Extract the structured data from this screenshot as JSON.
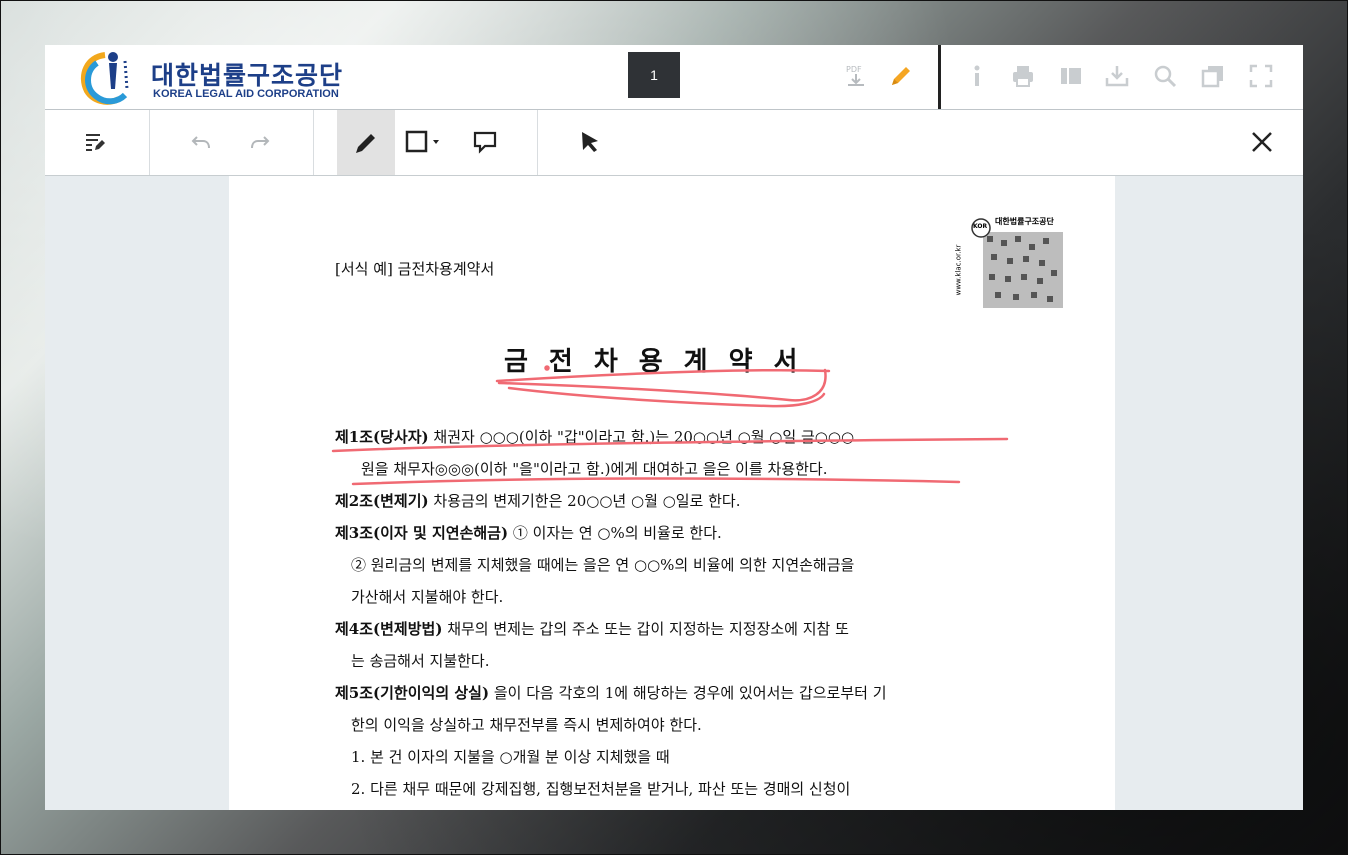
{
  "header": {
    "logo_title": "대한법률구조공단",
    "logo_subtitle": "KOREA LEGAL AID CORPORATION",
    "page_number": "1"
  },
  "icons": {
    "pdf": "pdf-download-icon",
    "pen_top": "pencil-icon",
    "info": "info-icon",
    "print": "print-icon",
    "layout": "layout-icon",
    "download": "download-icon",
    "search": "search-icon",
    "copy": "copy-icon",
    "fullscreen": "fullscreen-icon",
    "annotation_list": "annotation-list-icon",
    "undo": "undo-icon",
    "redo": "redo-icon",
    "pen": "pen-icon",
    "shape": "rectangle-shape-icon",
    "comment": "comment-icon",
    "select": "cursor-icon",
    "close": "close-icon"
  },
  "colors": {
    "accent_pen": "#f5a623",
    "annotation_ink": "#f06a73",
    "logo_blue": "#1d3f88"
  },
  "document": {
    "form_label": "[서식 예] 금전차용계약서",
    "title": "금전차용계약서",
    "stamp_text": "대한법률구조공단",
    "stamp_url": "www.klac.or.kr",
    "stamp_badge": "KOR",
    "paragraphs": [
      {
        "article": "제1조(당사자)",
        "text": " 채권자 ○○○(이하 \"갑\"이라고 함.)는 20○○년 ○월 ○일 금○○○"
      },
      {
        "article": "",
        "text": "원을 채무자◎◎◎(이하 \"을\"이라고 함.)에게 대여하고 을은 이를 차용한다."
      },
      {
        "article": "제2조(변제기)",
        "text": " 차용금의 변제기한은 20○○년 ○월 ○일로 한다."
      },
      {
        "article": "제3조(이자 및 지연손해금)",
        "text": "  ① 이자는 연 ○%의 비율로 한다."
      },
      {
        "article": "",
        "text": "② 원리금의 변제를 지체했을 때에는 을은 연  ○○%의 비율에 의한 지연손해금을"
      },
      {
        "article": "",
        "text": "가산해서 지불해야 한다."
      },
      {
        "article": "제4조(변제방법)",
        "text": " 채무의 변제는 갑의 주소 또는 갑이 지정하는 지정장소에 지참 또"
      },
      {
        "article": "",
        "text": "는 송금해서 지불한다."
      },
      {
        "article": "제5조(기한이익의 상실)",
        "text": "  을이 다음 각호의 1에 해당하는 경우에 있어서는 갑으로부터 기"
      },
      {
        "article": "",
        "text": "한의 이익을 상실하고 채무전부를 즉시 변제하여야 한다."
      },
      {
        "article": "",
        "text": "1. 본 건 이자의 지불을 ○개월 분 이상 지체했을 때"
      },
      {
        "article": "",
        "text": "2. 다른 채무 때문에 강제집행, 집행보전처분을 받거나, 파산 또는 경매의 신청이"
      }
    ]
  }
}
